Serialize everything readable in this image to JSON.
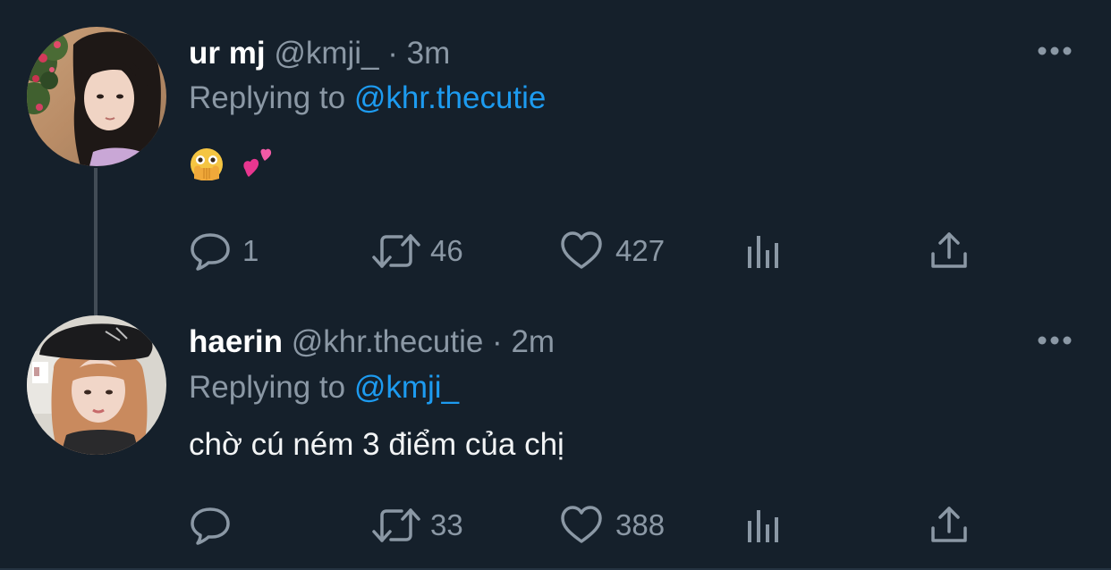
{
  "colors": {
    "background": "#15202b",
    "text_primary": "#ffffff",
    "text_secondary": "#8b98a5",
    "link": "#1d9bf0",
    "thread_line": "#424c56"
  },
  "tweets": [
    {
      "display_name": "ur mj",
      "handle": "@kmji_",
      "separator": "·",
      "time": "3m",
      "replying_label": "Replying to",
      "replying_handle": "@khr.thecutie",
      "text": "",
      "emojis": [
        "face-with-open-eyes-and-hand-over-mouth",
        "two-hearts"
      ],
      "stats": {
        "replies": "1",
        "retweets": "46",
        "likes": "427",
        "views": ""
      },
      "icons": {
        "more": "more-horizontal-icon",
        "reply": "reply-bubble-icon",
        "retweet": "retweet-icon",
        "like": "heart-icon",
        "views": "analytics-bars-icon",
        "share": "share-upload-icon"
      }
    },
    {
      "display_name": "haerin",
      "handle": "@khr.thecutie",
      "separator": "·",
      "time": "2m",
      "replying_label": "Replying to",
      "replying_handle": "@kmji_",
      "text": "chờ cú ném 3 điểm của chị",
      "stats": {
        "replies": "",
        "retweets": "33",
        "likes": "388",
        "views": ""
      },
      "icons": {
        "more": "more-horizontal-icon",
        "reply": "reply-bubble-icon",
        "retweet": "retweet-icon",
        "like": "heart-icon",
        "views": "analytics-bars-icon",
        "share": "share-upload-icon"
      }
    }
  ]
}
